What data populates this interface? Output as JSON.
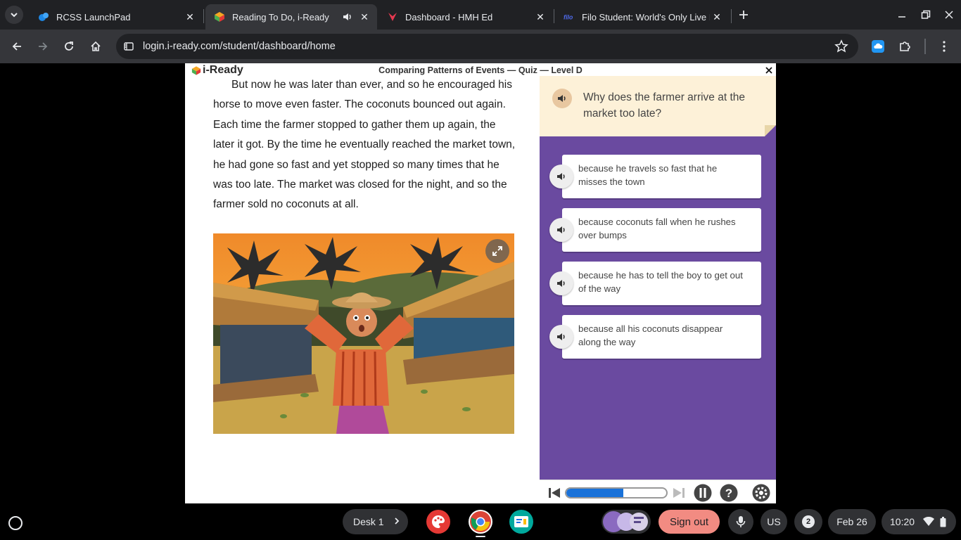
{
  "browser": {
    "tabs": [
      {
        "title": "RCSS LaunchPad",
        "favicon": "launchpad-icon"
      },
      {
        "title": "Reading To Do, i-Ready",
        "favicon": "iready-icon",
        "active": true
      },
      {
        "title": "Dashboard - HMH Ed",
        "favicon": "hmh-icon"
      },
      {
        "title": "Filo Student: World's Only Live I",
        "favicon": "filo-icon"
      }
    ],
    "url": "login.i-ready.com/student/dashboard/home"
  },
  "header": {
    "logo_text": "i-Ready",
    "title": "Comparing Patterns of Events — Quiz — Level D"
  },
  "passage": {
    "text": "But now he was later than ever, and so he encouraged his horse to move even faster. The coconuts bounced out again. Each time the farmer stopped to gather them up again, the later it got. By the time he eventually reached the market town, he had gone so fast and yet stopped so many times that he was too late. The market was closed for the night, and so the farmer sold no coconuts at all."
  },
  "quiz": {
    "question": "Why does the farmer arrive at the market too late?",
    "answers": [
      "because he travels so fast that he misses the town",
      "because coconuts fall when he rushes over bumps",
      "because he has to tell the boy to get out of the way",
      "because all his coconuts disappear along the way"
    ],
    "progress": 0.57
  },
  "shelf": {
    "desk_label": "Desk 1",
    "signout_label": "Sign out",
    "ime_label": "US",
    "notification_count": "2",
    "date": "Feb 26",
    "time": "10:20"
  },
  "colors": {
    "panel_purple": "#6a4aa0",
    "question_bg": "#fdf1d8",
    "progress_blue": "#1a72d9",
    "signout_red": "#f28b82"
  }
}
